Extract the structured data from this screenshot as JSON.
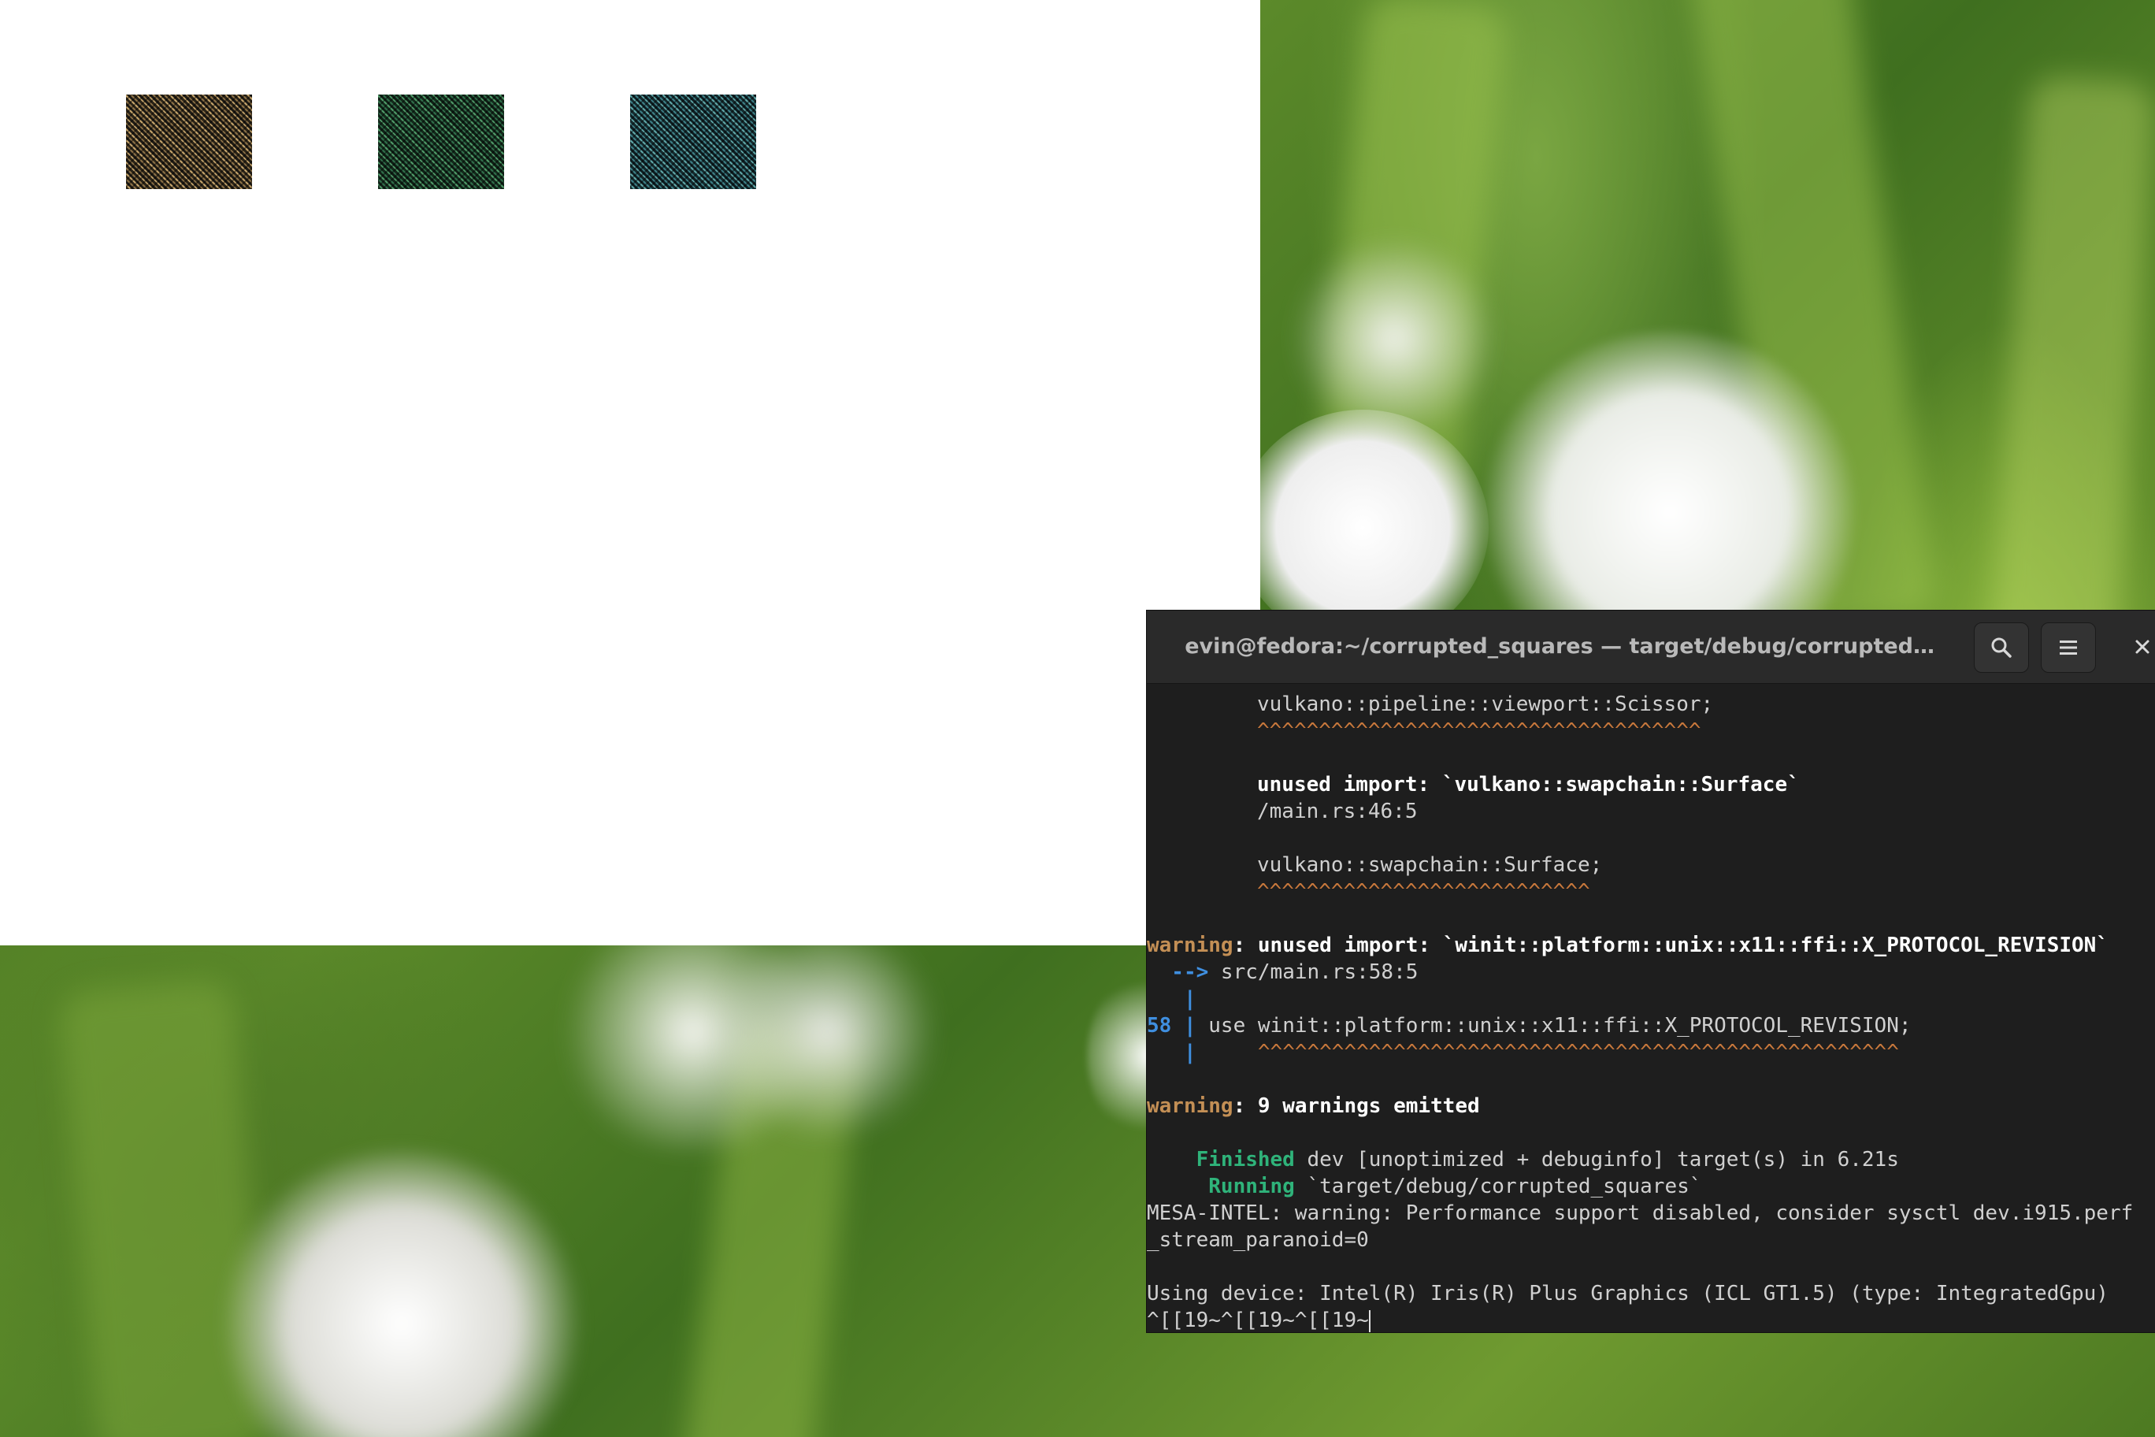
{
  "terminal": {
    "title": "evin@fedora:~/corrupted_squares — target/debug/corrupted…",
    "close_glyph": "×",
    "lines": [
      {
        "pre": "",
        "prefix": "",
        "text": "vulkano::pipeline::viewport::Scissor;"
      },
      {
        "pre": "",
        "prefix": "",
        "caret": "^^^^^^^^^^^^^^^^^^^^^^^^^^^^^^^^^^^^"
      },
      {
        "blank": true
      },
      {
        "pre": "",
        "prefix": "",
        "bold": "unused import: `vulkano::swapchain::Surface`"
      },
      {
        "pre": "",
        "prefix": "",
        "text": "/main.rs:46:5"
      },
      {
        "blank": true
      },
      {
        "pre": "",
        "prefix": "",
        "text": "vulkano::swapchain::Surface;"
      },
      {
        "pre": "",
        "prefix": "",
        "caret": "^^^^^^^^^^^^^^^^^^^^^^^^^^^"
      },
      {
        "blank": true
      },
      {
        "warn": "warning",
        "bold": ": unused import: `winit::platform::unix::x11::ffi::X_PROTOCOL_REVISION`"
      },
      {
        "blue": "  -->",
        "text": " src/main.rs:58:5"
      },
      {
        "blue": "   |"
      },
      {
        "blue": "58 |",
        "text": " use winit::platform::unix::x11::ffi::X_PROTOCOL_REVISION;"
      },
      {
        "blue": "   |",
        "caret": "     ^^^^^^^^^^^^^^^^^^^^^^^^^^^^^^^^^^^^^^^^^^^^^^^^^^^^"
      },
      {
        "blank": true
      },
      {
        "warn": "warning",
        "bold": ": 9 warnings emitted"
      },
      {
        "blank": true
      },
      {
        "green": "    Finished",
        "text": " dev [unoptimized + debuginfo] target(s) in 6.21s"
      },
      {
        "green": "     Running",
        "text": " `target/debug/corrupted_squares`"
      },
      {
        "text": "MESA-INTEL: warning: Performance support disabled, consider sysctl dev.i915.perf"
      },
      {
        "text": "_stream_paranoid=0"
      },
      {
        "blank": true
      },
      {
        "text": "Using device: Intel(R) Iris(R) Plus Graphics (ICL GT1.5) (type: IntegratedGpu)"
      },
      {
        "text": "^[[19~^[[19~^[[19~",
        "cursor": true
      }
    ]
  },
  "icons": {
    "search": "search-icon",
    "menu": "hamburger-menu-icon",
    "close": "close-icon"
  },
  "colors": {
    "terminal_bg": "#1e1e1e",
    "warning": "#c38f55",
    "gutter_blue": "#3f8fe0",
    "cargo_green": "#2fb37a",
    "caret_orange": "#c8783c"
  }
}
